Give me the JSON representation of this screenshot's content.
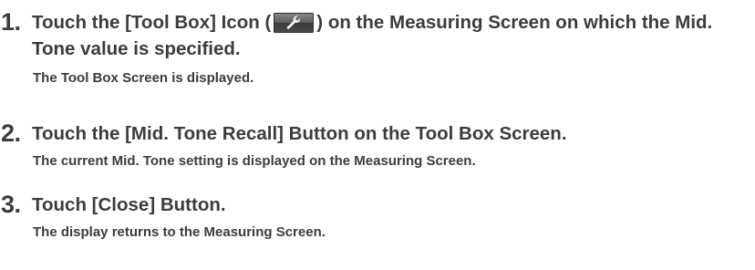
{
  "steps": [
    {
      "number": "1.",
      "title_before_icon": "Touch the [Tool Box] Icon (",
      "icon": "wrench-icon",
      "title_after_icon": ") on the Measuring Screen on which the Mid. Tone value is specified.",
      "result": "The Tool Box Screen is displayed."
    },
    {
      "number": "2.",
      "title": "Touch the [Mid. Tone Recall] Button on the Tool Box Screen.",
      "result": "The current Mid. Tone setting is displayed on the Measuring Screen."
    },
    {
      "number": "3.",
      "title": "Touch [Close] Button.",
      "result": "The display returns to the Measuring Screen."
    }
  ]
}
